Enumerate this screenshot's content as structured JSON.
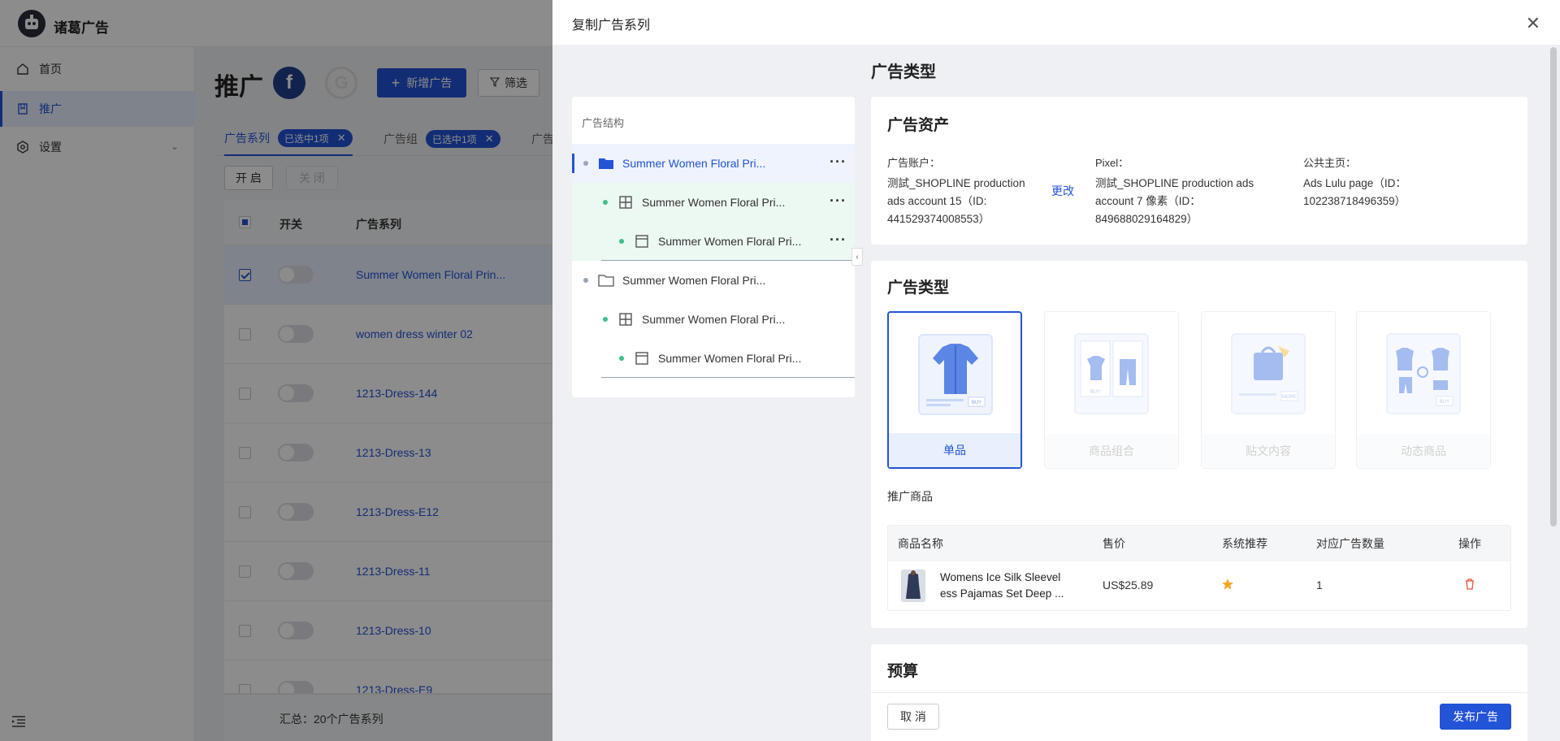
{
  "app": {
    "name": "诸葛广告"
  },
  "sidebar": {
    "items": [
      {
        "label": "首页"
      },
      {
        "label": "推广"
      },
      {
        "label": "设置"
      }
    ]
  },
  "main": {
    "title": "推广",
    "fb_letter": "f",
    "g_letter": "G",
    "add_ad_label": "新增广告",
    "filter_label": "筛选",
    "tabs": [
      {
        "label": "广告系列",
        "tag": "已选中1项"
      },
      {
        "label": "广告组",
        "tag": "已选中1项"
      },
      {
        "label": "广告"
      }
    ],
    "enable_label": "开 启",
    "disable_label": "关 闭",
    "table": {
      "headers": [
        "开关",
        "广告系列"
      ],
      "rows": [
        {
          "name": "Summer Women Floral Prin...",
          "checked": true
        },
        {
          "name": "women dress winter 02",
          "checked": false
        },
        {
          "name": "1213-Dress-144",
          "checked": false
        },
        {
          "name": "1213-Dress-13",
          "checked": false
        },
        {
          "name": "1213-Dress-E12",
          "checked": false
        },
        {
          "name": "1213-Dress-11",
          "checked": false
        },
        {
          "name": "1213-Dress-10",
          "checked": false
        },
        {
          "name": "1213-Dress-E9",
          "checked": false
        }
      ],
      "summary": "汇总：20个广告系列"
    }
  },
  "drawer": {
    "title": "复制广告系列",
    "section_heading": "广告类型",
    "tree": {
      "heading": "广告结构",
      "nodes": [
        {
          "label": "Summer Women Floral Pri...",
          "kind": "campaign"
        },
        {
          "label": "Summer Women Floral Pri...",
          "kind": "adset"
        },
        {
          "label": "Summer Women Floral Pri...",
          "kind": "ad"
        },
        {
          "label": "Summer Women Floral Pri...",
          "kind": "campaign"
        },
        {
          "label": "Summer Women Floral Pri...",
          "kind": "adset"
        },
        {
          "label": "Summer Women Floral Pri...",
          "kind": "ad"
        }
      ],
      "more_label": "···"
    },
    "assets": {
      "title": "广告资产",
      "account_label": "广告账户：",
      "account_value": "测試_SHOPLINE production ads account 15（ID: 441529374008553）",
      "change_label": "更改",
      "pixel_label": "Pixel：",
      "pixel_value": "测試_SHOPLINE production ads account 7 像素（ID：849688029164829）",
      "page_label": "公共主页：",
      "page_value": "Ads Lulu page（ID：102238718496359）"
    },
    "ad_type": {
      "title": "广告类型",
      "options": [
        {
          "label": "单品",
          "selected": true,
          "badge": "BUY"
        },
        {
          "label": "商品组合",
          "selected": false,
          "badge": "BUY"
        },
        {
          "label": "贴文内容",
          "selected": false,
          "badge": "MORE"
        },
        {
          "label": "动态商品",
          "selected": false,
          "badge": "BUY"
        }
      ],
      "products_label": "推广商品",
      "products_table": {
        "headers": [
          "商品名称",
          "售价",
          "系统推荐",
          "对应广告数量",
          "操作"
        ],
        "rows": [
          {
            "name_line1": "Womens Ice Silk Sleevel",
            "name_line2": "ess Pajamas Set Deep ...",
            "price": "US$25.89",
            "recommended": true,
            "ad_count": "1"
          }
        ]
      }
    },
    "budget": {
      "title": "预算"
    },
    "footer": {
      "cancel_label": "取 消",
      "publish_label": "发布广告"
    }
  },
  "colors": {
    "primary": "#2353d6",
    "green": "#3dbf8a",
    "danger": "#e5543f",
    "star": "#f5a623"
  }
}
